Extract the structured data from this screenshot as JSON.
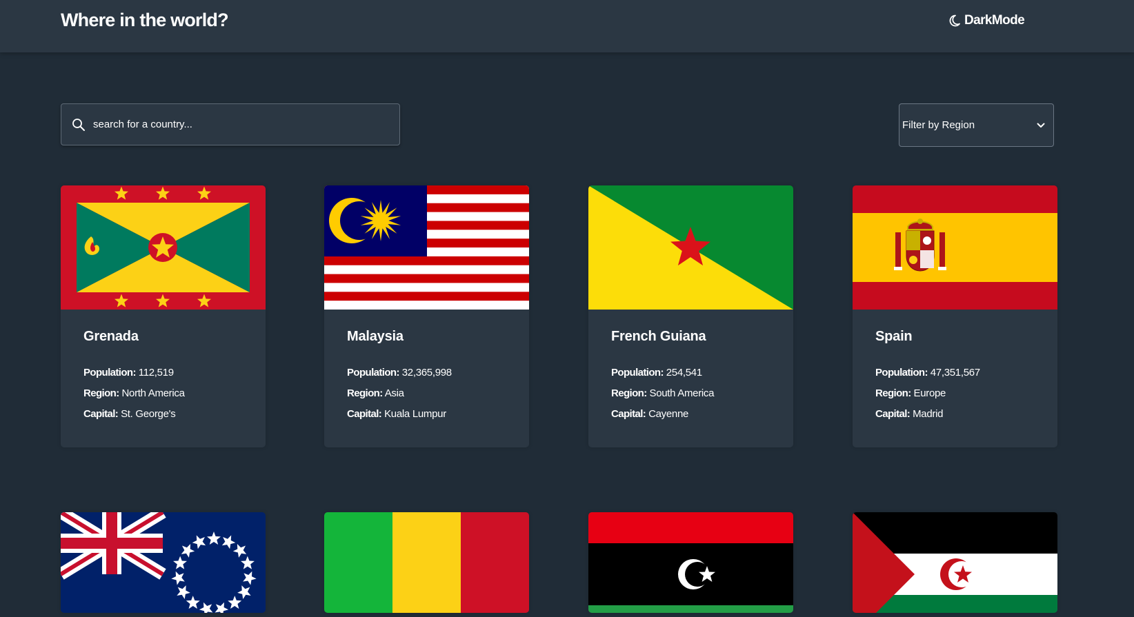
{
  "header": {
    "title": "Where in the world?",
    "mode_label": "DarkMode",
    "mode_icon": "moon-icon"
  },
  "search": {
    "placeholder": "search for a country...",
    "value": "",
    "icon": "search-icon"
  },
  "filter": {
    "selected": "Filter by Region",
    "icon": "chevron-down-icon"
  },
  "labels": {
    "population": "Population:",
    "region": "Region:",
    "capital": "Capital:"
  },
  "countries": [
    {
      "name": "Grenada",
      "population": "112,519",
      "region": "North America",
      "capital": "St. George's",
      "flag": "grenada-flag"
    },
    {
      "name": "Malaysia",
      "population": "32,365,998",
      "region": "Asia",
      "capital": "Kuala Lumpur",
      "flag": "malaysia-flag"
    },
    {
      "name": "French Guiana",
      "population": "254,541",
      "region": "South America",
      "capital": "Cayenne",
      "flag": "french-guiana-flag"
    },
    {
      "name": "Spain",
      "population": "47,351,567",
      "region": "Europe",
      "capital": "Madrid",
      "flag": "spain-flag"
    },
    {
      "flag": "cook-islands-flag"
    },
    {
      "flag": "mali-flag"
    },
    {
      "flag": "libya-flag"
    },
    {
      "flag": "western-sahara-flag"
    }
  ],
  "colors": {
    "background": "#202c37",
    "element": "#2b3743",
    "text": "#ffffff"
  }
}
